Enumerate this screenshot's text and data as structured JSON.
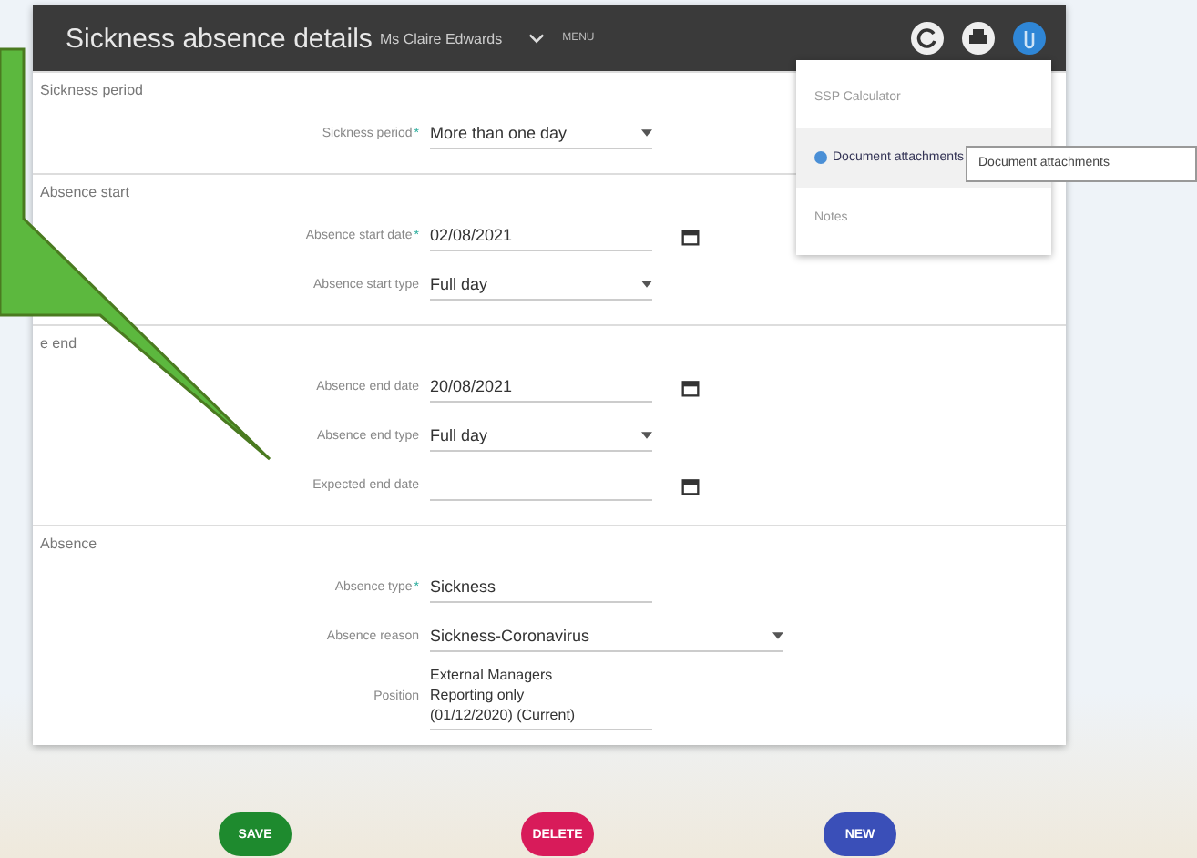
{
  "header": {
    "title": "Sickness absence details",
    "subtitle": "Ms Claire Edwards",
    "menu_label": "MENU"
  },
  "sections": [
    {
      "title": "Sickness period",
      "fields": [
        {
          "label": "Sickness period",
          "required_mark": "*",
          "kind": "select",
          "value": "More than one day"
        }
      ]
    },
    {
      "title": "Absence start",
      "fields": [
        {
          "label": "Absence start date",
          "required_mark": "*",
          "kind": "date",
          "value": "02/08/2021"
        },
        {
          "label": "Absence start type",
          "kind": "select",
          "value": "Full day"
        }
      ]
    },
    {
      "title": "e end",
      "fields": [
        {
          "label": "Absence end date",
          "kind": "date",
          "value": "20/08/2021"
        },
        {
          "label": "Absence end type",
          "kind": "select",
          "value": "Full day"
        },
        {
          "label": "Expected end date",
          "kind": "date"
        }
      ]
    },
    {
      "title": "Absence",
      "fields": [
        {
          "label": "Absence type",
          "required_mark": "*",
          "kind": "text",
          "value": "Sickness"
        },
        {
          "label": "Absence reason",
          "kind": "select",
          "wide": true,
          "value": "Sickness-Coronavirus"
        },
        {
          "label": "Position",
          "kind": "multiline",
          "lines": [
            "External Managers",
            "Reporting only",
            "(01/12/2020) (Current)"
          ]
        }
      ]
    }
  ],
  "menu": {
    "items": [
      {
        "label": "SSP Calculator",
        "selected": false
      },
      {
        "label": "Document attachments",
        "selected": true
      },
      {
        "label": "Notes",
        "selected": false
      }
    ]
  },
  "tooltip": "Document attachments",
  "buttons": [
    {
      "label": "SAVE",
      "color": "#1e8a2e"
    },
    {
      "label": "DELETE",
      "color": "#d81b5a"
    },
    {
      "label": "NEW",
      "color": "#3a4fb8"
    }
  ]
}
